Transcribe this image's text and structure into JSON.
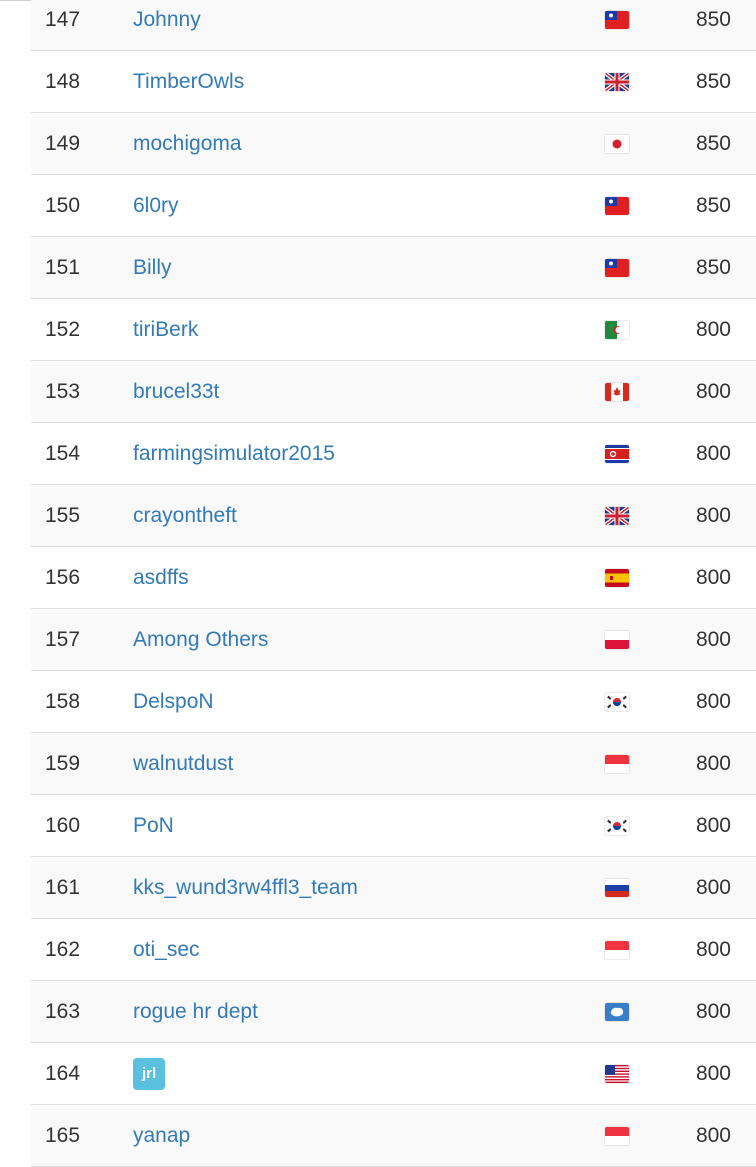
{
  "scoreboard": {
    "rows": [
      {
        "rank": "147",
        "team": "Johnny",
        "flag": "taiwan-flag-icon",
        "score": "850"
      },
      {
        "rank": "148",
        "team": "TimberOwls",
        "flag": "united-kingdom-flag-icon",
        "score": "850"
      },
      {
        "rank": "149",
        "team": "mochigoma",
        "flag": "japan-flag-icon",
        "score": "850"
      },
      {
        "rank": "150",
        "team": "6l0ry",
        "flag": "taiwan-flag-icon",
        "score": "850"
      },
      {
        "rank": "151",
        "team": "Billy",
        "flag": "taiwan-flag-icon",
        "score": "850"
      },
      {
        "rank": "152",
        "team": "tiriBerk",
        "flag": "algeria-flag-icon",
        "score": "800"
      },
      {
        "rank": "153",
        "team": "brucel33t",
        "flag": "canada-flag-icon",
        "score": "800"
      },
      {
        "rank": "154",
        "team": "farmingsimulator2015",
        "flag": "north-korea-flag-icon",
        "score": "800"
      },
      {
        "rank": "155",
        "team": "crayontheft",
        "flag": "united-kingdom-flag-icon",
        "score": "800"
      },
      {
        "rank": "156",
        "team": "asdffs",
        "flag": "spain-flag-icon",
        "score": "800"
      },
      {
        "rank": "157",
        "team": "Among Others",
        "flag": "poland-flag-icon",
        "score": "800"
      },
      {
        "rank": "158",
        "team": "DelspoN",
        "flag": "south-korea-flag-icon",
        "score": "800"
      },
      {
        "rank": "159",
        "team": "walnutdust",
        "flag": "singapore-flag-icon",
        "score": "800"
      },
      {
        "rank": "160",
        "team": "PoN",
        "flag": "south-korea-flag-icon",
        "score": "800"
      },
      {
        "rank": "161",
        "team": "kks_wund3rw4ffl3_team",
        "flag": "russia-flag-icon",
        "score": "800"
      },
      {
        "rank": "162",
        "team": "oti_sec",
        "flag": "singapore-flag-icon",
        "score": "800"
      },
      {
        "rank": "163",
        "team": "rogue hr dept",
        "flag": "antarctica-flag-icon",
        "score": "800"
      },
      {
        "rank": "164",
        "team": "jrl",
        "flag": "united-states-flag-icon",
        "score": "800",
        "badge": true
      },
      {
        "rank": "165",
        "team": "yanap",
        "flag": "singapore-flag-icon",
        "score": "800"
      }
    ]
  },
  "colors": {
    "link": "#337ab7",
    "badge": "#5bc0de",
    "stripe": "#f9f9f9",
    "border": "#dddddd",
    "text": "#333333"
  }
}
